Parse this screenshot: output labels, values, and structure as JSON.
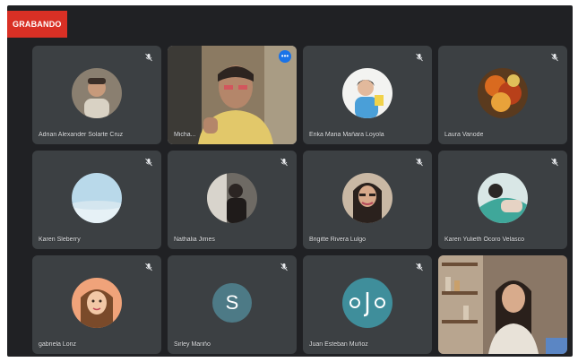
{
  "meeting": {
    "recording_badge": "GRABANDO",
    "participants": [
      {
        "name": "Adrian Alexander Solarte Cruz",
        "avatar": "photo-icon",
        "muted": true
      },
      {
        "name": "Micha...",
        "avatar": "video",
        "muted": false,
        "speaking": true
      },
      {
        "name": "Erika Maria Mañara Loyola",
        "avatar": "photo-icon",
        "muted": true
      },
      {
        "name": "Laura Vanode",
        "avatar": "photo-icon",
        "muted": true
      },
      {
        "name": "Karen Sleberry",
        "avatar": "photo-icon",
        "muted": true
      },
      {
        "name": "Nathalia Jimes",
        "avatar": "photo-icon",
        "muted": true
      },
      {
        "name": "Brigitte Rivera Lulgo",
        "avatar": "photo-icon",
        "muted": true
      },
      {
        "name": "Karen Yulieth Ocoro Velasco",
        "avatar": "photo-icon",
        "muted": true
      },
      {
        "name": "gabriela Lonz",
        "avatar": "photo-icon",
        "muted": true
      },
      {
        "name": "Sirley Mariño",
        "avatar_letter": "S",
        "muted": true
      },
      {
        "name": "Juan Esteban Muñoz",
        "avatar": "logo-icon",
        "muted": true
      },
      {
        "name": "",
        "avatar": "video",
        "muted": false
      }
    ]
  },
  "colors": {
    "background": "#202124",
    "tile": "#3c4043",
    "active_outline": "#8ab4f8",
    "badge": "#d93025",
    "letter_avatar": "#4d7a86"
  }
}
